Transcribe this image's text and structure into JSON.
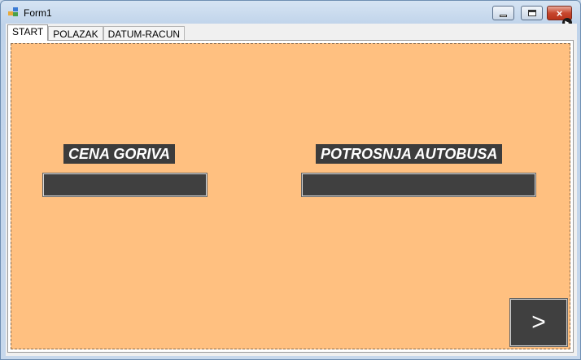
{
  "window": {
    "title": "Form1",
    "controls": {
      "minimize": "minimize-icon",
      "maximize": "maximize-icon",
      "close": "×"
    }
  },
  "tabs": [
    {
      "label": "START",
      "active": true
    },
    {
      "label": "POLAZAK",
      "active": false
    },
    {
      "label": "DATUM-RACUN",
      "active": false
    }
  ],
  "start_page": {
    "panel_color": "#ffc080",
    "fuel_price": {
      "label": "CENA GORIVA",
      "value": ""
    },
    "bus_consumption": {
      "label": "POTROSNJA AUTOBUSA",
      "value": ""
    },
    "next_button": {
      "label": ">"
    }
  }
}
